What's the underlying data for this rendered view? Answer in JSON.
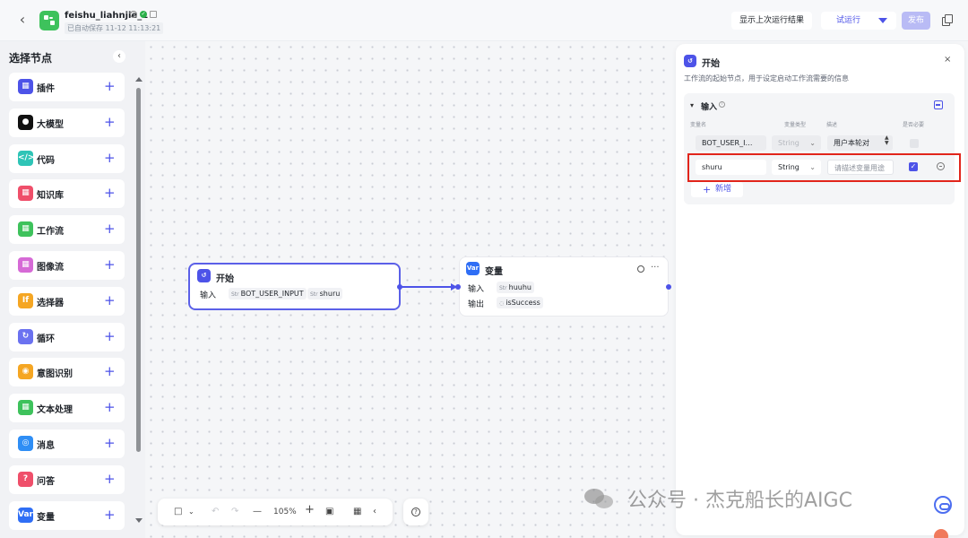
{
  "header": {
    "workflow_name": "feishu_liahnjie_1",
    "autosave": "已自动保存 11-12 11:13:21",
    "show_last_run": "显示上次运行结果",
    "test_run": "试运行",
    "publish": "发布"
  },
  "sidebar": {
    "title": "选择节点",
    "items": [
      {
        "label": "插件",
        "icon": "plugin-icon",
        "color": "#4d53e8"
      },
      {
        "label": "大模型",
        "icon": "llm-icon",
        "color": "#111111"
      },
      {
        "label": "代码",
        "icon": "code-icon",
        "color": "#2ec4b6"
      },
      {
        "label": "知识库",
        "icon": "knowledge-icon",
        "color": "#ef4f6a"
      },
      {
        "label": "工作流",
        "icon": "workflow-icon",
        "color": "#3ec25c"
      },
      {
        "label": "图像流",
        "icon": "imageflow-icon",
        "color": "#d66ad6"
      },
      {
        "label": "选择器",
        "icon": "selector-icon",
        "color": "#f5a623"
      },
      {
        "label": "循环",
        "icon": "loop-icon",
        "color": "#6b72f0"
      },
      {
        "label": "意图识别",
        "icon": "intent-icon",
        "color": "#f5a623"
      },
      {
        "label": "文本处理",
        "icon": "text-icon",
        "color": "#3ec25c"
      },
      {
        "label": "消息",
        "icon": "message-icon",
        "color": "#2f8ef5"
      },
      {
        "label": "问答",
        "icon": "qa-icon",
        "color": "#ef4f6a"
      },
      {
        "label": "变量",
        "icon": "variable-icon",
        "color": "#2f6ef5"
      }
    ]
  },
  "canvas": {
    "start_node": {
      "title": "开始",
      "input_label": "输入",
      "inputs": [
        {
          "type": "Str",
          "name": "BOT_USER_INPUT"
        },
        {
          "type": "Str",
          "name": "shuru"
        }
      ]
    },
    "var_node": {
      "icon_text": "Var",
      "title": "变量",
      "input_label": "输入",
      "input": {
        "type": "Str",
        "name": "huuhu"
      },
      "output_label": "输出",
      "output": {
        "name": "isSuccess"
      }
    },
    "toolbar": {
      "zoom": "105%"
    }
  },
  "panel": {
    "title": "开始",
    "description": "工作流的起始节点，用于设定启动工作流需要的信息",
    "section_title": "输入",
    "columns": [
      "变量名",
      "变量类型",
      "描述",
      "是否必要"
    ],
    "rows": [
      {
        "name": "BOT_USER_I…",
        "type": "String",
        "description": "用户本轮对",
        "required": false
      },
      {
        "name": "shuru",
        "type": "String",
        "description_placeholder": "请描述变量用途",
        "required": true
      }
    ],
    "add_label": "新增"
  },
  "watermark": "公众号 · 杰克船长的AIGC"
}
